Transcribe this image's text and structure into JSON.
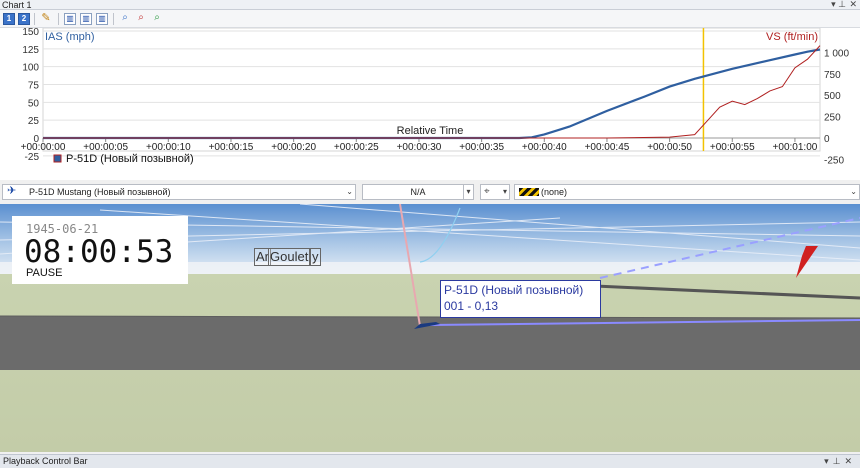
{
  "window": {
    "chart_title": "Chart 1",
    "bottom_title": "Playback Control Bar",
    "pin_glyph": "▾ ⊥",
    "close_glyph": "✕"
  },
  "toolbar": {
    "btn1": "1",
    "btn2": "2"
  },
  "chart_data": {
    "type": "line",
    "x_axis_label": "Relative Time",
    "x_ticks": [
      "+00:00:00",
      "+00:00:05",
      "+00:00:10",
      "+00:00:15",
      "+00:00:20",
      "+00:00:25",
      "+00:00:30",
      "+00:00:35",
      "+00:00:40",
      "+00:00:45",
      "+00:00:50",
      "+00:00:55",
      "+00:01:00"
    ],
    "left_axis": {
      "label": "IAS (mph)",
      "ticks": [
        "150",
        "125",
        "100",
        "75",
        "50",
        "25",
        "0",
        "-25"
      ],
      "range": [
        -25,
        150
      ]
    },
    "right_axis": {
      "label": "VS (ft/min)",
      "ticks": [
        "1 000",
        "750",
        "500",
        "250",
        "0",
        "-250"
      ],
      "range": [
        -250,
        1200
      ]
    },
    "series": [
      {
        "name": "P-51D (Новый позывной)",
        "axis": "left",
        "color": "#2f5fa0",
        "x": [
          0,
          5,
          10,
          15,
          20,
          25,
          30,
          35,
          38,
          39,
          40,
          42,
          45,
          48,
          50,
          52,
          55,
          58,
          60,
          61,
          62
        ],
        "y": [
          0,
          0,
          0,
          0,
          0,
          0,
          0,
          0,
          0,
          1,
          5,
          16,
          38,
          58,
          72,
          83,
          97,
          109,
          117,
          121,
          124
        ]
      },
      {
        "axis": "right",
        "color": "#b02020",
        "x": [
          0,
          35,
          38,
          40,
          45,
          50,
          52,
          53,
          54,
          55,
          56,
          57,
          58,
          59,
          60,
          61,
          62
        ],
        "y": [
          0,
          0,
          0,
          0,
          0,
          10,
          40,
          200,
          360,
          430,
          390,
          460,
          550,
          600,
          820,
          920,
          1080
        ]
      }
    ],
    "cursor_x": 52.7,
    "legend": "bottom-left"
  },
  "selectors": {
    "aircraft": "P-51D Mustang (Новый позывной)",
    "metric": "N/A",
    "overlay": "(none)"
  },
  "scene": {
    "date": "1945-06-21",
    "time": "08:00:53",
    "mode": "PAUSE",
    "label_a": "Ar",
    "label_b": "Goulet",
    "label_c": "y",
    "tag_line1": "P-51D (Новый позывной)",
    "tag_line2": "001 - 0,13"
  },
  "colors": {
    "ias": "#2f5fa0",
    "vs": "#b02020",
    "cursor": "#f2c200",
    "tag": "#2b3aa0"
  }
}
